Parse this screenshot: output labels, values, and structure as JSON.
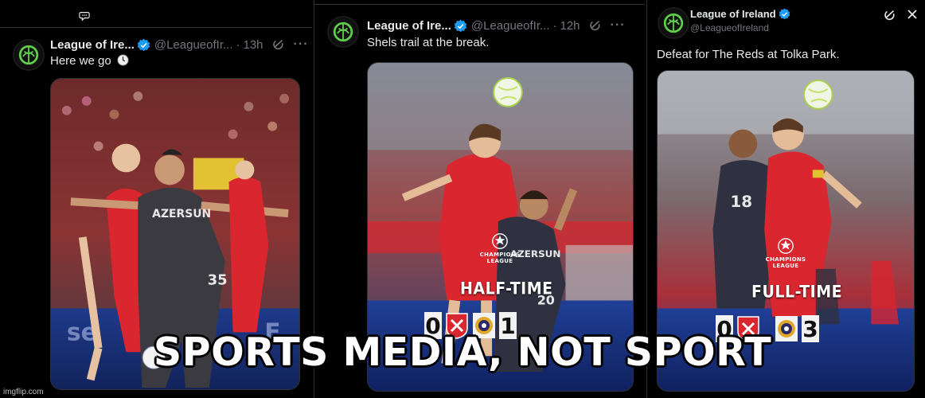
{
  "caption": "SPORTS MEDIA, NOT SPORT",
  "watermark": "imgflip.com",
  "accent": {
    "verified": "#1d9bf0",
    "text": "#e7e9ea",
    "muted": "#71767b",
    "background": "#000000",
    "home_red": "#d9262f",
    "ucl_blue": "#1f3b8f"
  },
  "tweets": [
    {
      "name": "League of Ire...",
      "handle": "@LeagueofIr...",
      "time": "13h",
      "text": "Here we go",
      "text_icon": "clock-icon",
      "more": "···",
      "media": {
        "shirt_sponsor": "AZERSUN",
        "number": "35"
      }
    },
    {
      "name": "League of Ire...",
      "handle": "@LeagueofIr...",
      "time": "12h",
      "text": "Shels trail at the break.",
      "more": "···",
      "media": {
        "competition_line1": "CHAMPIONS",
        "competition_line2": "LEAGUE",
        "phase": "HALF-TIME",
        "home_score": "0",
        "away_score": "1",
        "shirt_sponsor": "AZERSUN",
        "number": "20"
      }
    },
    {
      "name": "League of Ireland",
      "handle": "@LeagueofIreland",
      "text": "Defeat for The Reds at Tolka Park.",
      "media": {
        "competition_line1": "CHAMPIONS",
        "competition_line2": "LEAGUE",
        "phase": "FULL-TIME",
        "home_score": "0",
        "away_score": "3",
        "number": "18"
      }
    }
  ]
}
